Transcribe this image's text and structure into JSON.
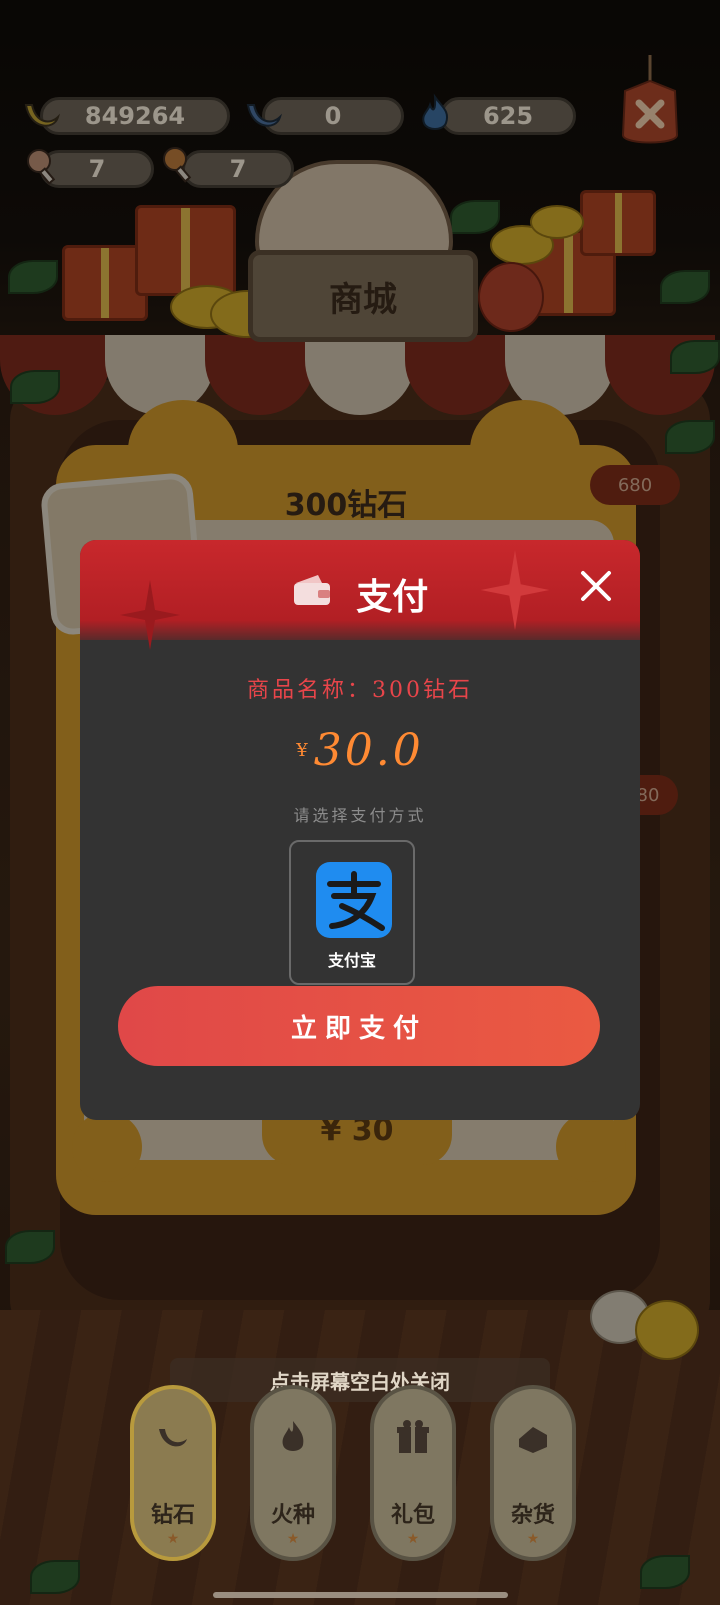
{
  "resources": {
    "banana": "849264",
    "fish": "0",
    "fire": "625",
    "drumstick_a": "7",
    "drumstick_b": "7"
  },
  "shop_title": "商城",
  "product_card": {
    "title": "300钻石",
    "price": "¥ 30",
    "side_tag_1": "680",
    "side_tag_2": "80"
  },
  "payment": {
    "title": "支付",
    "product_line": "商品名称：300钻石",
    "currency": "¥",
    "amount": "30.0",
    "method_hint": "请选择支付方式",
    "method_label": "支付宝",
    "pay_button": "立即支付"
  },
  "close_hint": "点击屏幕空白处关闭",
  "tabs": [
    {
      "label": "钻石",
      "icon": "diamond-icon"
    },
    {
      "label": "火种",
      "icon": "flame-icon"
    },
    {
      "label": "礼包",
      "icon": "gift-icon"
    },
    {
      "label": "杂货",
      "icon": "goods-icon"
    }
  ],
  "colors": {
    "header_red": "#c8282c",
    "pay_button": "#e04848",
    "amount_orange": "#ff8a33",
    "alipay_blue": "#1f8cf0"
  }
}
